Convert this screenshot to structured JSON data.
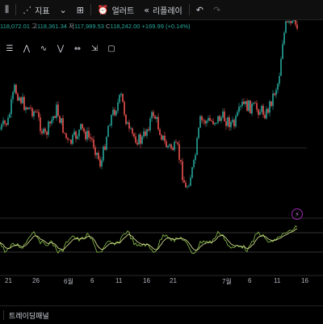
{
  "toolbar": {
    "indicators_label": "지표",
    "alert_label": "얼러트",
    "replay_label": "리플레이",
    "icons": [
      "candle-settings-icon",
      "indicators-icon",
      "dropdown-icon",
      "grid-icon",
      "alert-icon",
      "replay-icon",
      "undo-icon",
      "redo-icon"
    ]
  },
  "ohlc": {
    "open": "118,072.01",
    "high_label": "고",
    "high": "118,361.34",
    "low_label": "저",
    "low": "117,989.53",
    "close": "118,242.00",
    "change": "+169.99 (+0.14%)"
  },
  "drawing_tools": [
    "align-icon",
    "pattern-icon",
    "wave-icon",
    "zigzag-icon",
    "range-icon",
    "bracket-icon",
    "frame-icon"
  ],
  "time_axis": {
    "labels": [
      "21",
      "26",
      "6월",
      "6",
      "11",
      "16",
      "21",
      "7월",
      "6",
      "11",
      "16"
    ]
  },
  "bottom": {
    "panel_label": "트레이딩패널"
  },
  "colors": {
    "up": "#26a69a",
    "down": "#ef5350",
    "oscillator_main": "#8bc34a",
    "oscillator_signal": "#e6ee9c",
    "alert_bolt": "#9c27b0"
  }
}
